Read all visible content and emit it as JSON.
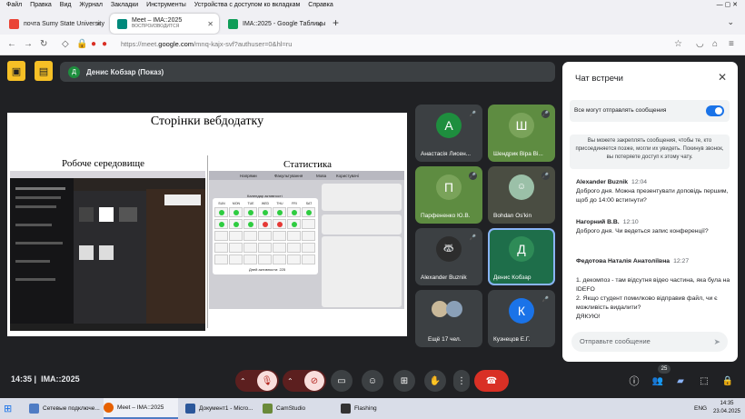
{
  "browser": {
    "menu": [
      "Файл",
      "Правка",
      "Вид",
      "Журнал",
      "Закладки",
      "Инструменты",
      "Устройства с доступом ко вкладкам",
      "Справка"
    ],
    "tabs": [
      {
        "label": "почта Sumy State University",
        "sub": ""
      },
      {
        "label": "Meet – IMA::2025",
        "sub": "ВОСПРОИЗВОДИТСЯ"
      },
      {
        "label": "IMA::2025 - Google Таблицы",
        "sub": ""
      }
    ],
    "url_prefix": "https://meet.",
    "url_domain": "google.com",
    "url_rest": "/mnq-kajx-svf?authuser=0&hl=ru"
  },
  "meeting": {
    "presenter_initial": "Д",
    "presenter_title": "Денис Кобзар (Показ)",
    "time": "14:35",
    "name": "IMA::2025",
    "participants_count": "25"
  },
  "slide": {
    "title": "Сторінки вебдодатку",
    "left_caption": "Робоче середовище",
    "right_caption": "Статистика",
    "mini_nav": [
      "Напрями",
      "Факультування",
      "Мова",
      "Користувачі"
    ],
    "mini_calendar_title": "Календар активності",
    "mini_days": [
      "SUN",
      "MON",
      "TUE",
      "WED",
      "THU",
      "FRI",
      "SAT"
    ],
    "mini_activity": "Дней активности:",
    "mini_activity_val": "225"
  },
  "tiles": [
    {
      "initial": "А",
      "name": "Анастасія Лисен...",
      "color": "#1e8e3e"
    },
    {
      "initial": "Ш",
      "name": "Шендрик Віра Ві...",
      "color": "#5e8c41"
    },
    {
      "initial": "П",
      "name": "Парфененко Ю.В.",
      "color": "#5e8c41"
    },
    {
      "initial": "",
      "name": "Bohdan Os'kin",
      "color": ""
    },
    {
      "initial": "",
      "name": "Alexander Buznik",
      "color": ""
    },
    {
      "initial": "Д",
      "name": "Денис Кобзар",
      "color": "#1e8e3e"
    },
    {
      "initial": "",
      "name": "Ещё 17 чел.",
      "color": ""
    },
    {
      "initial": "К",
      "name": "Кузнецов Е.Г.",
      "color": "#1a73e8"
    }
  ],
  "chat": {
    "header": "Чат встречи",
    "permission": "Все могут отправлять сообщения",
    "info": "Вы можете закреплять сообщения, чтобы те, кто присоединяется позже, могли их увидеть. Покинув звонок, вы потеряете доступ к этому чату.",
    "messages": [
      {
        "author": "Alexander Buznik",
        "time": "12:04",
        "text": "Доброго дня. Можна презентувати доповідь першим, щоб до 14:00 встигнути?"
      },
      {
        "author": "Нагорний В.В.",
        "time": "12:10",
        "text": "Доброго дня. Чи ведеться запис конференції?"
      },
      {
        "author": "Федотова Наталія Анатоліївна",
        "time": "12:27",
        "text": "1. декомпоз - там відсутня відео частина, яка була на IDEFO\n2. Якщо студент помилково відправив файл, чи є можливість видалити?\nДЯКУЮ!"
      }
    ],
    "input_placeholder": "Отправьте сообщение"
  },
  "taskbar": [
    "Сетевые подключе...",
    "Meet – IMA::2025",
    "Документ1 - Micro...",
    "CamStudio",
    "Flashing"
  ],
  "systray": {
    "lang": "ENG",
    "time": "14:35",
    "date": "23.04.2025"
  }
}
